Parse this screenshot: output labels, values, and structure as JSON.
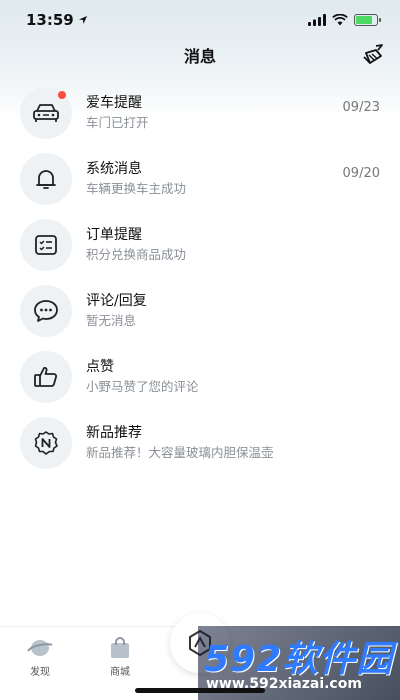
{
  "status_bar": {
    "time": "13:59"
  },
  "header": {
    "title": "消息"
  },
  "messages": [
    {
      "icon": "car-icon",
      "title": "爱车提醒",
      "subtitle": "车门已打开",
      "date": "09/23",
      "unread": true
    },
    {
      "icon": "bell-icon",
      "title": "系统消息",
      "subtitle": "车辆更换车主成功",
      "date": "09/20",
      "unread": false
    },
    {
      "icon": "checklist-icon",
      "title": "订单提醒",
      "subtitle": "积分兑换商品成功",
      "date": "",
      "unread": false
    },
    {
      "icon": "chat-bubble-icon",
      "title": "评论/回复",
      "subtitle": "暂无消息",
      "date": "",
      "unread": false
    },
    {
      "icon": "thumbs-up-icon",
      "title": "点赞",
      "subtitle": "小野马赞了您的评论",
      "date": "",
      "unread": false
    },
    {
      "icon": "n-badge-icon",
      "title": "新品推荐",
      "subtitle": "新品推荐！大容量玻璃内胆保温壶",
      "date": "",
      "unread": false
    }
  ],
  "tabs": [
    {
      "icon": "planet-icon",
      "label": "发现"
    },
    {
      "icon": "shopping-bag-icon",
      "label": "商城"
    }
  ],
  "watermark": {
    "main": "592软件园",
    "url": "www.592xiazai.com"
  },
  "colors": {
    "accent_dot": "#ff4a3d",
    "icon_bg": "#eef2f4",
    "watermark_blue": "#2f7bff"
  }
}
